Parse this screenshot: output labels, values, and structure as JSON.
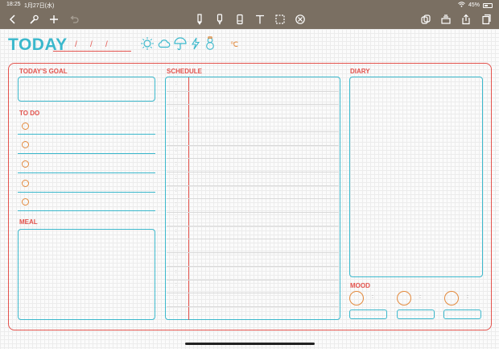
{
  "status": {
    "time": "18:25",
    "date": "1月27日(水)",
    "battery": "45%"
  },
  "toolbar": {
    "icons": [
      "back-icon",
      "wrench-icon",
      "plus-icon",
      "undo-icon",
      "pen-icon",
      "highlighter-icon",
      "eraser-icon",
      "text-icon",
      "lasso-icon",
      "shape-icon",
      "share-icon",
      "layers-icon",
      "export-icon",
      "pages-icon"
    ]
  },
  "page": {
    "title": "TODAY",
    "date_separators": [
      "/",
      "/",
      "/"
    ],
    "weather_icons": [
      "sun-icon",
      "cloud-icon",
      "umbrella-icon",
      "lightning-icon",
      "snowman-icon"
    ],
    "celsius": "℃",
    "goal_label": "TODAY'S GOAL",
    "todo_label": "TO DO",
    "meal_label": "MEAL",
    "schedule_label": "SCHEDULE",
    "diary_label": "DIARY",
    "mood_label": "MOOD",
    "schedule_colon": ":",
    "mood_colon": ":"
  },
  "colors": {
    "accent_red": "#e3534d",
    "accent_cyan": "#3bb8cc",
    "accent_orange": "#e38a3d",
    "toolbar": "#7a6f62"
  }
}
